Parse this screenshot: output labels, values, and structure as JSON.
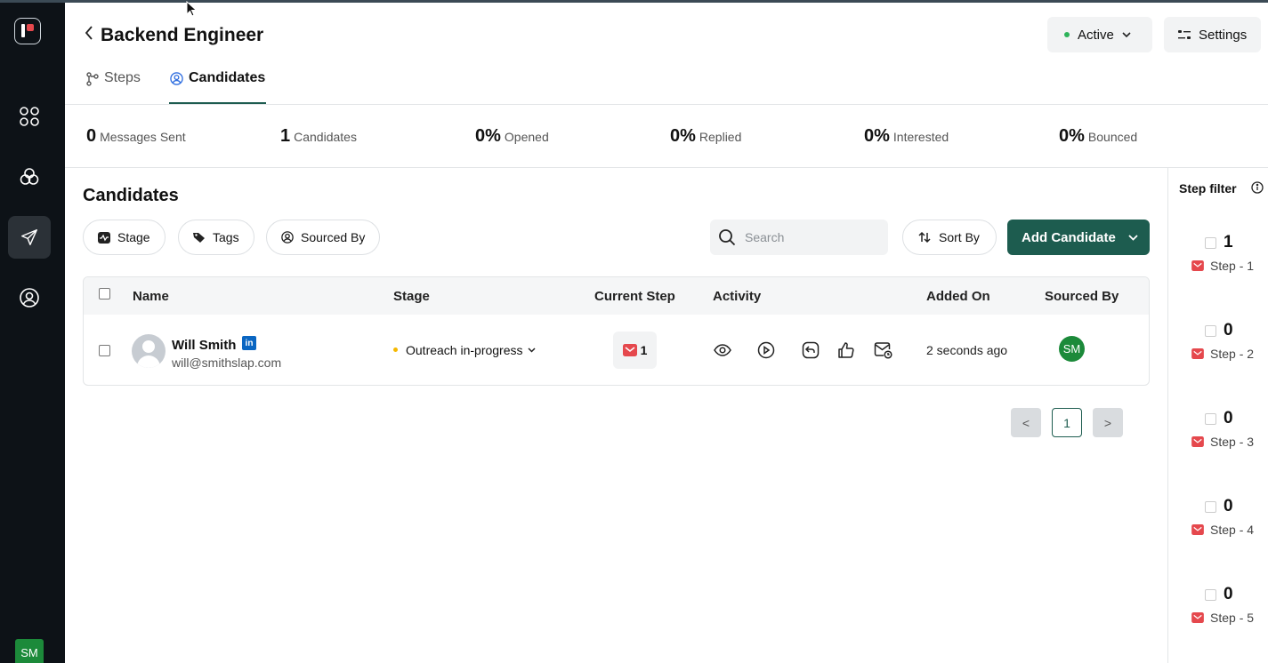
{
  "sidebar": {
    "user_initials": "SM",
    "nav": [
      {
        "icon": "grid-icon"
      },
      {
        "icon": "circles-icon"
      },
      {
        "icon": "paper-plane-icon",
        "active": true
      },
      {
        "icon": "user-circle-icon"
      }
    ]
  },
  "header": {
    "title": "Backend Engineer",
    "status_label": "Active",
    "settings_label": "Settings"
  },
  "tabs": [
    {
      "label": "Steps",
      "active": false
    },
    {
      "label": "Candidates",
      "active": true
    }
  ],
  "stats": [
    {
      "value": "0",
      "label": "Messages Sent"
    },
    {
      "value": "1",
      "label": "Candidates"
    },
    {
      "value": "0%",
      "label": "Opened"
    },
    {
      "value": "0%",
      "label": "Replied"
    },
    {
      "value": "0%",
      "label": "Interested"
    },
    {
      "value": "0%",
      "label": "Bounced"
    }
  ],
  "main": {
    "title": "Candidates",
    "filters": [
      "Stage",
      "Tags",
      "Sourced By"
    ],
    "search_placeholder": "Search",
    "sort_label": "Sort By",
    "add_label": "Add Candidate"
  },
  "table": {
    "columns": [
      "Name",
      "Stage",
      "Current Step",
      "Activity",
      "Added On",
      "Sourced By"
    ],
    "rows": [
      {
        "name": "Will Smith",
        "email": "will@smithslap.com",
        "linkedin": "in",
        "stage": "Outreach in-progress",
        "current_step": "1",
        "activity_icons": [
          "eye-icon",
          "play-circle-icon",
          "reply-icon",
          "thumbs-up-icon",
          "mail-clock-icon"
        ],
        "added_on": "2 seconds ago",
        "sourced_by": "SM"
      }
    ]
  },
  "pagination": {
    "prev": "<",
    "current": "1",
    "next": ">"
  },
  "step_filter": {
    "title": "Step filter",
    "steps": [
      {
        "count": "1",
        "label": "Step - 1"
      },
      {
        "count": "0",
        "label": "Step - 2"
      },
      {
        "count": "0",
        "label": "Step - 3"
      },
      {
        "count": "0",
        "label": "Step - 4"
      },
      {
        "count": "0",
        "label": "Step - 5"
      }
    ]
  },
  "colors": {
    "primary": "#1d5c4f",
    "rail": "#0d1217",
    "mail_red": "#e5484d",
    "avatar_green": "#1c8a3a"
  }
}
